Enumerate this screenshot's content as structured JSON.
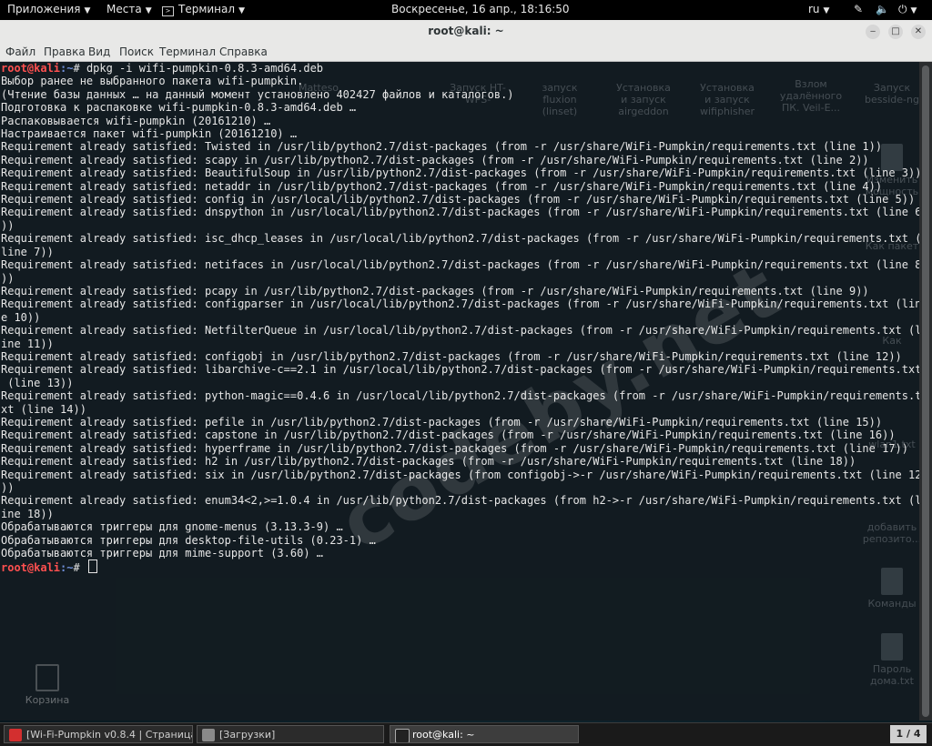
{
  "topbar": {
    "applications": "Приложения",
    "places": "Места",
    "terminal_menu": "Терминал",
    "clock": "Воскресенье, 16 апр., 18:16:50",
    "lang": "ru"
  },
  "window": {
    "title": "root@kali: ~",
    "menu": [
      "Файл",
      "Правка",
      "Вид",
      "Поиск",
      "Терминал",
      "Справка"
    ]
  },
  "terminal": {
    "prompt_user": "root@kali",
    "prompt_path": ":~",
    "prompt_symbol": "# ",
    "command": "dpkg -i wifi-pumpkin-0.8.3-amd64.deb",
    "lines": [
      "Выбор ранее не выбранного пакета wifi-pumpkin.",
      "(Чтение базы данных … на данный момент установлено 402427 файлов и каталогов.)",
      "Подготовка к распаковке wifi-pumpkin-0.8.3-amd64.deb …",
      "Распаковывается wifi-pumpkin (20161210) …",
      "Настраивается пакет wifi-pumpkin (20161210) …",
      "Requirement already satisfied: Twisted in /usr/lib/python2.7/dist-packages (from -r /usr/share/WiFi-Pumpkin/requirements.txt (line 1))",
      "Requirement already satisfied: scapy in /usr/lib/python2.7/dist-packages (from -r /usr/share/WiFi-Pumpkin/requirements.txt (line 2))",
      "Requirement already satisfied: BeautifulSoup in /usr/lib/python2.7/dist-packages (from -r /usr/share/WiFi-Pumpkin/requirements.txt (line 3))",
      "Requirement already satisfied: netaddr in /usr/lib/python2.7/dist-packages (from -r /usr/share/WiFi-Pumpkin/requirements.txt (line 4))",
      "Requirement already satisfied: config in /usr/local/lib/python2.7/dist-packages (from -r /usr/share/WiFi-Pumpkin/requirements.txt (line 5))",
      "Requirement already satisfied: dnspython in /usr/local/lib/python2.7/dist-packages (from -r /usr/share/WiFi-Pumpkin/requirements.txt (line 6",
      "))",
      "Requirement already satisfied: isc_dhcp_leases in /usr/local/lib/python2.7/dist-packages (from -r /usr/share/WiFi-Pumpkin/requirements.txt (",
      "line 7))",
      "Requirement already satisfied: netifaces in /usr/local/lib/python2.7/dist-packages (from -r /usr/share/WiFi-Pumpkin/requirements.txt (line 8",
      "))",
      "Requirement already satisfied: pcapy in /usr/lib/python2.7/dist-packages (from -r /usr/share/WiFi-Pumpkin/requirements.txt (line 9))",
      "Requirement already satisfied: configparser in /usr/local/lib/python2.7/dist-packages (from -r /usr/share/WiFi-Pumpkin/requirements.txt (lin",
      "e 10))",
      "Requirement already satisfied: NetfilterQueue in /usr/local/lib/python2.7/dist-packages (from -r /usr/share/WiFi-Pumpkin/requirements.txt (l",
      "ine 11))",
      "Requirement already satisfied: configobj in /usr/lib/python2.7/dist-packages (from -r /usr/share/WiFi-Pumpkin/requirements.txt (line 12))",
      "Requirement already satisfied: libarchive-c==2.1 in /usr/local/lib/python2.7/dist-packages (from -r /usr/share/WiFi-Pumpkin/requirements.txt",
      " (line 13))",
      "Requirement already satisfied: python-magic==0.4.6 in /usr/local/lib/python2.7/dist-packages (from -r /usr/share/WiFi-Pumpkin/requirements.t",
      "xt (line 14))",
      "Requirement already satisfied: pefile in /usr/lib/python2.7/dist-packages (from -r /usr/share/WiFi-Pumpkin/requirements.txt (line 15))",
      "Requirement already satisfied: capstone in /usr/lib/python2.7/dist-packages (from -r /usr/share/WiFi-Pumpkin/requirements.txt (line 16))",
      "Requirement already satisfied: hyperframe in /usr/lib/python2.7/dist-packages (from -r /usr/share/WiFi-Pumpkin/requirements.txt (line 17))",
      "Requirement already satisfied: h2 in /usr/lib/python2.7/dist-packages (from -r /usr/share/WiFi-Pumpkin/requirements.txt (line 18))",
      "Requirement already satisfied: six in /usr/lib/python2.7/dist-packages (from configobj->-r /usr/share/WiFi-Pumpkin/requirements.txt (line 12",
      "))",
      "Requirement already satisfied: enum34<2,>=1.0.4 in /usr/lib/python2.7/dist-packages (from h2->-r /usr/share/WiFi-Pumpkin/requirements.txt (l",
      "ine 18))",
      "Обрабатываются триггеры для gnome-menus (3.13.3-9) …",
      "Обрабатываются триггеры для desktop-file-utils (0.23-1) …",
      "Обрабатываются триггеры для mime-support (3.60) …"
    ]
  },
  "desktop": {
    "icons": [
      {
        "label": "Matteso",
        "col": 0
      },
      {
        "label": "Запуск HT-WPS-",
        "col": 1
      },
      {
        "label": "запуск fluxion (linset)",
        "col": 2
      },
      {
        "label": "Установка и запуск airgeddon",
        "col": 3
      },
      {
        "label": "Установка и запуск wifiphisher",
        "col": 4
      },
      {
        "label": "Взлом удалённого ПК. Veil-E...",
        "col": 5
      },
      {
        "label": "Запуск besside-ng",
        "col": 6
      }
    ],
    "right_icons": [
      "Изменить мощность",
      "Как пакет",
      "Как",
      "wlan1.txt",
      "добавить репозито...",
      "Команды",
      "Пароль дома.txt"
    ],
    "trash_label": "Корзина",
    "watermark": "codeby.net"
  },
  "taskbar": {
    "items": [
      {
        "label": "[Wi-Fi-Pumpkin v0.8.4 | Страница ...",
        "icon_color": "#d32f2f",
        "active": false
      },
      {
        "label": "[Загрузки]",
        "icon_color": "#8a8a8a",
        "active": false
      },
      {
        "label": "root@kali: ~",
        "icon_color": "#222222",
        "active": true
      }
    ],
    "workspace": "1 / 4"
  }
}
